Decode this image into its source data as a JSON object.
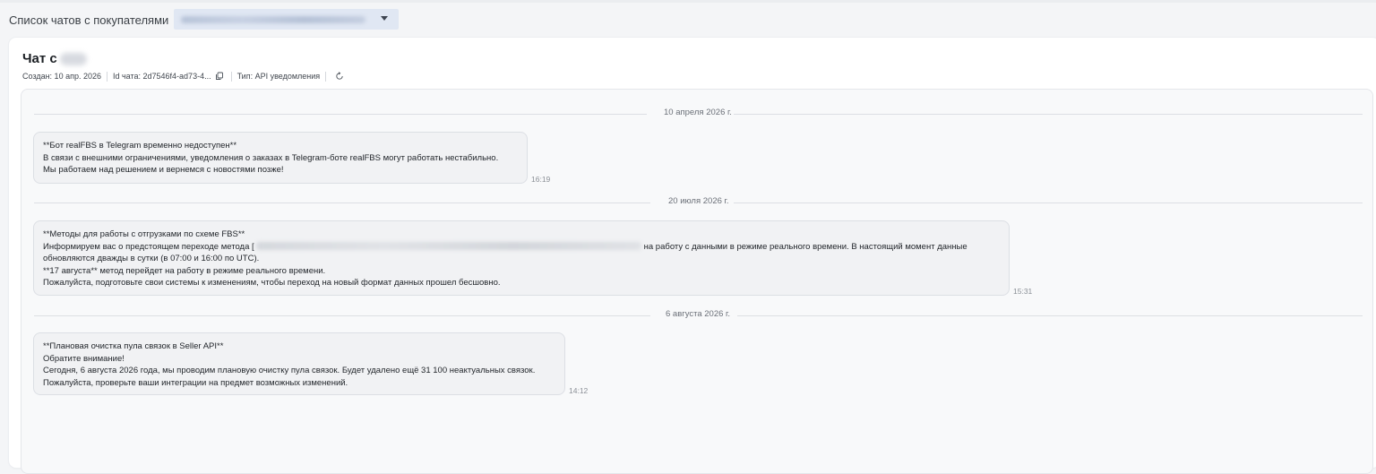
{
  "breadcrumb": {
    "link": "Список чатов с покупателями"
  },
  "chat": {
    "title_prefix": "Чат с",
    "meta": {
      "created": "Создан: 10 апр. 2026",
      "chat_id": "Id чата: 2d7546f4-ad73-4...",
      "type": "Тип: API уведомления"
    }
  },
  "days": [
    {
      "label": "10 апреля 2026 г."
    },
    {
      "label": "20 июля 2026 г."
    },
    {
      "label": "6 августа 2026 г."
    }
  ],
  "messages": [
    {
      "lines": [
        "**Бот realFBS в Telegram временно недоступен**",
        "В связи с внешними ограничениями, уведомления о заказах в Telegram-боте realFBS могут работать нестабильно.",
        "Мы работаем над решением и вернемся с новостями позже!"
      ],
      "time": "16:19"
    },
    {
      "lines": [
        "**Методы для работы с отгрузками по схеме FBS**",
        "Информируем вас о предстоящем переходе метода [",
        "на работу с данными в режиме реального времени. В настоящий момент данные",
        "обновляются дважды в сутки (в 07:00 и 16:00 по UTC).",
        "**17 августа** метод перейдет на работу в режиме реального времени.",
        "Пожалуйста, подготовьте свои системы к изменениям, чтобы переход на новый формат данных прошел бесшовно."
      ],
      "time": "15:31"
    },
    {
      "lines": [
        "**Плановая очистка пула связок в Seller API**",
        "Обратите внимание!",
        "Сегодня, 6 августа 2026 года, мы проводим плановую очистку пула связок. Будет удалено ещё 31 100 неактуальных связок.",
        "Пожалуйста, проверьте ваши интеграции на предмет возможных изменений."
      ],
      "time": "14:12"
    }
  ]
}
